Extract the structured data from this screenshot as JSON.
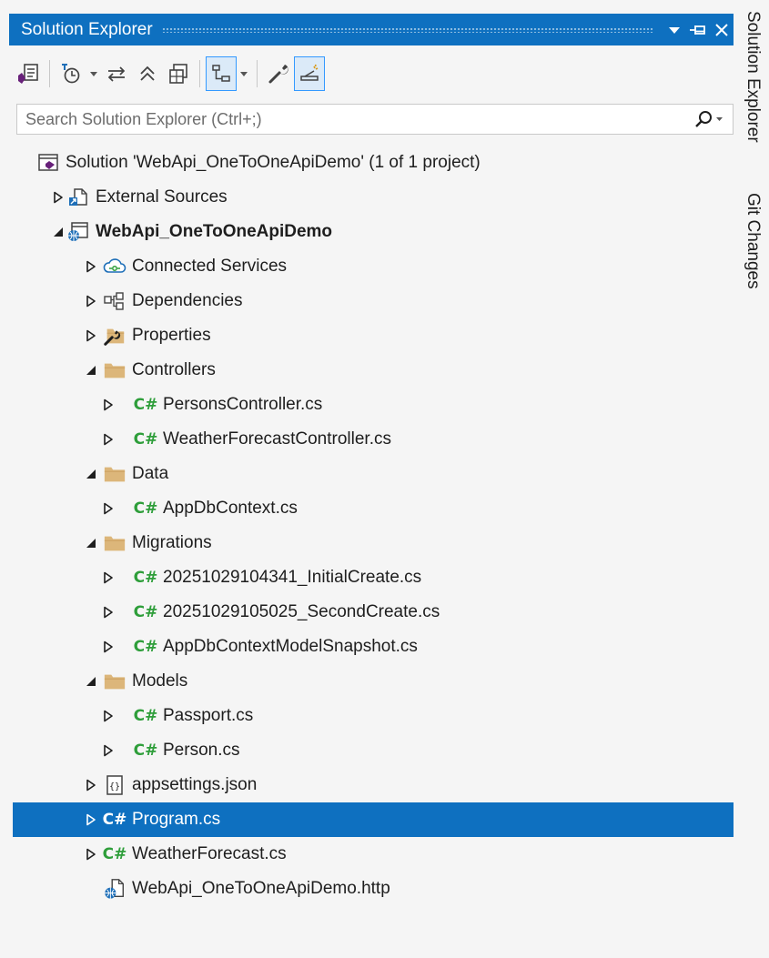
{
  "panel": {
    "title": "Solution Explorer",
    "controls": {
      "dropdown": "window-position-dropdown",
      "pin": "auto-hide-pin",
      "close": "close"
    }
  },
  "toolbar": {
    "buttons": [
      "switch-views",
      "pending-changes-filter",
      "sync-with-active-document",
      "collapse-all",
      "show-all-files",
      "preview-selected-items",
      "properties",
      "git-actions"
    ]
  },
  "search": {
    "placeholder": "Search Solution Explorer (Ctrl+;)"
  },
  "tree": [
    {
      "label": "Solution 'WebApi_OneToOneApiDemo' (1 of 1 project)",
      "icon": "solution-icon",
      "level": 0,
      "expander": "none"
    },
    {
      "label": "External Sources",
      "icon": "external-sources-icon",
      "level": 1,
      "expander": "collapsed"
    },
    {
      "label": "WebApi_OneToOneApiDemo",
      "icon": "web-project-icon",
      "level": 1,
      "expander": "expanded",
      "bold": true
    },
    {
      "label": "Connected Services",
      "icon": "connected-services-icon",
      "level": 2,
      "expander": "collapsed"
    },
    {
      "label": "Dependencies",
      "icon": "dependencies-icon",
      "level": 2,
      "expander": "collapsed"
    },
    {
      "label": "Properties",
      "icon": "properties-folder-icon",
      "level": 2,
      "expander": "collapsed"
    },
    {
      "label": "Controllers",
      "icon": "folder-icon",
      "level": 2,
      "expander": "expanded"
    },
    {
      "label": "PersonsController.cs",
      "icon": "csharp-file-icon",
      "level": 3,
      "expander": "collapsed"
    },
    {
      "label": "WeatherForecastController.cs",
      "icon": "csharp-file-icon",
      "level": 3,
      "expander": "collapsed"
    },
    {
      "label": "Data",
      "icon": "folder-icon",
      "level": 2,
      "expander": "expanded"
    },
    {
      "label": "AppDbContext.cs",
      "icon": "csharp-file-icon",
      "level": 3,
      "expander": "collapsed"
    },
    {
      "label": "Migrations",
      "icon": "folder-icon",
      "level": 2,
      "expander": "expanded"
    },
    {
      "label": "20251029104341_InitialCreate.cs",
      "icon": "csharp-file-icon",
      "level": 3,
      "expander": "collapsed"
    },
    {
      "label": "20251029105025_SecondCreate.cs",
      "icon": "csharp-file-icon",
      "level": 3,
      "expander": "collapsed"
    },
    {
      "label": "AppDbContextModelSnapshot.cs",
      "icon": "csharp-file-icon",
      "level": 3,
      "expander": "collapsed"
    },
    {
      "label": "Models",
      "icon": "folder-icon",
      "level": 2,
      "expander": "expanded"
    },
    {
      "label": "Passport.cs",
      "icon": "csharp-file-icon",
      "level": 3,
      "expander": "collapsed"
    },
    {
      "label": "Person.cs",
      "icon": "csharp-file-icon",
      "level": 3,
      "expander": "collapsed"
    },
    {
      "label": "appsettings.json",
      "icon": "json-file-icon",
      "level": 2,
      "expander": "collapsed"
    },
    {
      "label": "Program.cs",
      "icon": "csharp-file-icon",
      "level": 2,
      "expander": "collapsed",
      "selected": true
    },
    {
      "label": "WeatherForecast.cs",
      "icon": "csharp-file-icon",
      "level": 2,
      "expander": "collapsed"
    },
    {
      "label": "WebApi_OneToOneApiDemo.http",
      "icon": "http-file-icon",
      "level": 2,
      "expander": "none"
    }
  ],
  "csharp_glyph": "C#",
  "side_tabs": [
    "Solution Explorer",
    "Git Changes"
  ],
  "colors": {
    "accent": "#0e70c0",
    "panel_bg": "#f5f5f5",
    "csharp_green": "#2e9e3a",
    "folder": "#dcb67a",
    "vs_purple": "#68217a",
    "globe_blue": "#1e6fb8"
  }
}
